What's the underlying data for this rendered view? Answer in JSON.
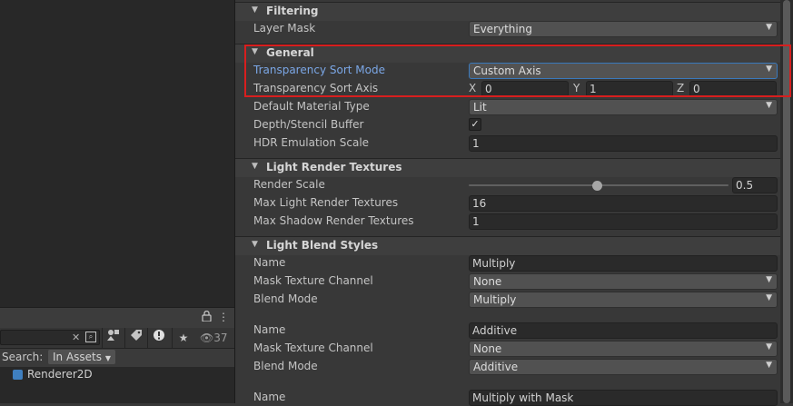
{
  "project": {
    "hidden_count": "37",
    "search_label": "Search:",
    "search_scope": "In Assets",
    "asset_name": "Renderer2D",
    "icons": [
      "lock-icon",
      "more-options-icon",
      "clear-search-icon",
      "search-window-icon",
      "filter-by-type-icon",
      "filter-by-label-icon",
      "errors-filter-icon",
      "favorites-star-icon",
      "hidden-packages-eye-icon",
      "renderer-asset-icon"
    ]
  },
  "inspector": {
    "filtering": {
      "title": "Filtering",
      "layer_mask_label": "Layer Mask",
      "layer_mask_value": "Everything"
    },
    "general": {
      "title": "General",
      "sort_mode_label": "Transparency Sort Mode",
      "sort_mode_value": "Custom Axis",
      "sort_axis_label": "Transparency Sort Axis",
      "axis": [
        {
          "letter": "X",
          "value": "0"
        },
        {
          "letter": "Y",
          "value": "1"
        },
        {
          "letter": "Z",
          "value": "0"
        }
      ],
      "material_type_label": "Default Material Type",
      "material_type_value": "Lit",
      "depth_label": "Depth/Stencil Buffer",
      "depth_checked": true,
      "hdr_label": "HDR Emulation Scale",
      "hdr_value": "1"
    },
    "light_render_textures": {
      "title": "Light Render Textures",
      "render_scale_label": "Render Scale",
      "render_scale_value": "0.5",
      "render_scale_min": 0.01,
      "render_scale_max": 1.0,
      "max_light_label": "Max Light Render Textures",
      "max_light_value": "16",
      "max_shadow_label": "Max Shadow Render Textures",
      "max_shadow_value": "1"
    },
    "light_blend_styles": {
      "title": "Light Blend Styles",
      "styles": [
        {
          "name_label": "Name",
          "name_value": "Multiply",
          "mask_label": "Mask Texture Channel",
          "mask_value": "None",
          "blend_label": "Blend Mode",
          "blend_value": "Multiply"
        },
        {
          "name_label": "Name",
          "name_value": "Additive",
          "mask_label": "Mask Texture Channel",
          "mask_value": "None",
          "blend_label": "Blend Mode",
          "blend_value": "Additive"
        },
        {
          "name_label": "Name",
          "name_value": "Multiply with Mask"
        }
      ]
    }
  },
  "colors": {
    "highlight": "#d81e1e",
    "active_label": "#7ba7e6",
    "focus_border": "#3a79bb"
  }
}
